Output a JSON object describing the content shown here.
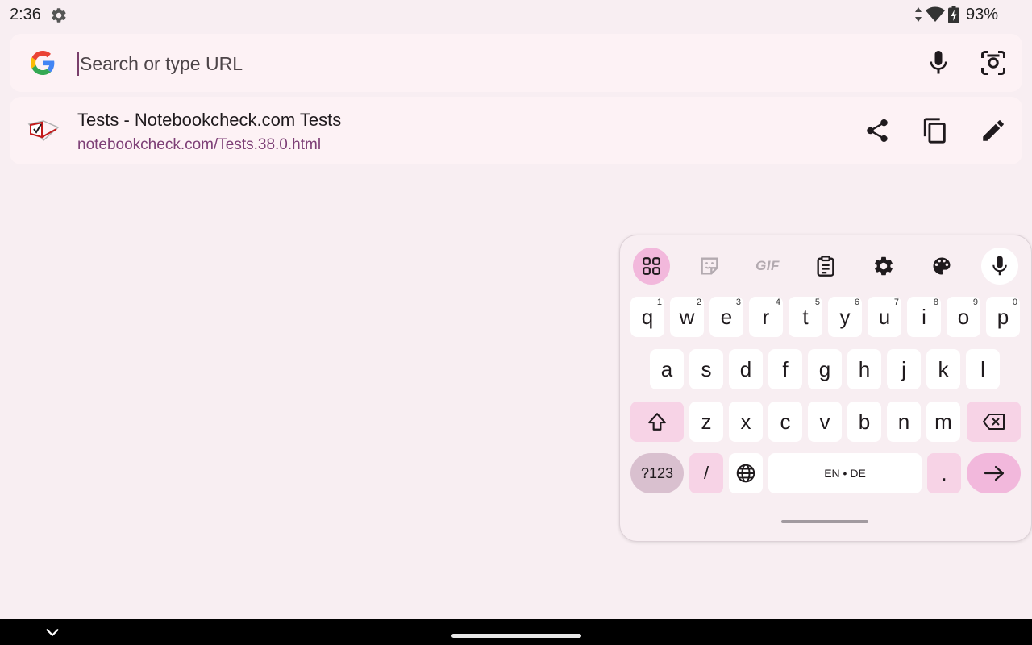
{
  "status": {
    "time": "2:36",
    "battery_percent": "93%"
  },
  "search": {
    "placeholder": "Search or type URL"
  },
  "suggestion": {
    "title": "Tests - Notebookcheck.com Tests",
    "url": "notebookcheck.com/Tests.38.0.html",
    "actions": [
      "share-icon",
      "copy-icon",
      "edit-icon"
    ]
  },
  "keyboard": {
    "toolbar": [
      "apps-grid-icon",
      "sticker-icon",
      "gif-icon",
      "clipboard-icon",
      "settings-icon",
      "palette-icon",
      "mic-icon"
    ],
    "gif_label": "GIF",
    "row1": [
      {
        "key": "q",
        "hint": "1"
      },
      {
        "key": "w",
        "hint": "2"
      },
      {
        "key": "e",
        "hint": "3"
      },
      {
        "key": "r",
        "hint": "4"
      },
      {
        "key": "t",
        "hint": "5"
      },
      {
        "key": "y",
        "hint": "6"
      },
      {
        "key": "u",
        "hint": "7"
      },
      {
        "key": "i",
        "hint": "8"
      },
      {
        "key": "o",
        "hint": "9"
      },
      {
        "key": "p",
        "hint": "0"
      }
    ],
    "row2": [
      "a",
      "s",
      "d",
      "f",
      "g",
      "h",
      "j",
      "k",
      "l"
    ],
    "row3": [
      "z",
      "x",
      "c",
      "v",
      "b",
      "n",
      "m"
    ],
    "symbols_label": "?123",
    "slash_label": "/",
    "space_label": "EN • DE",
    "period_label": ".",
    "colors": {
      "active": "#f2b8dc",
      "function_key": "#f7d3e6",
      "symbols_key": "#d9c0cf"
    }
  },
  "colors": {
    "background": "#f8eef2",
    "card": "#fdf2f5",
    "url_accent": "#7d3f76"
  }
}
